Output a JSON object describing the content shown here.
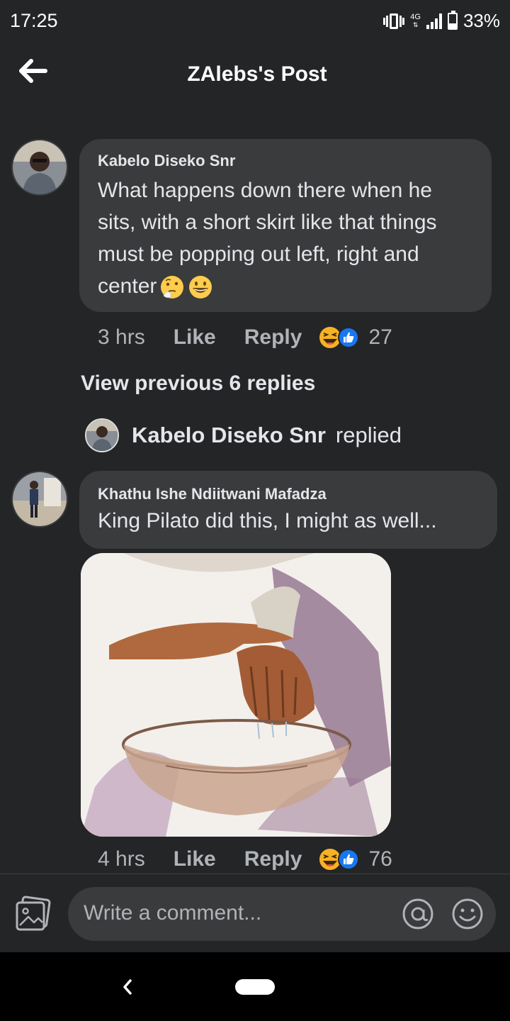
{
  "status_bar": {
    "time": "17:25",
    "network": "4G",
    "battery": "33%",
    "battery_level": 0.33
  },
  "header": {
    "title": "ZAlebs's Post",
    "back_icon": "arrow-left-icon"
  },
  "comments": [
    {
      "author": "Kabelo Diseko Snr",
      "text": "What happens down there when he sits, with a short skirt like that things must be popping out left, right and center",
      "emojis": [
        "thinking-face-icon",
        "grinning-face-icon"
      ],
      "time": "3 hrs",
      "like_label": "Like",
      "reply_label": "Reply",
      "reactions": [
        "laugh-reaction-icon",
        "like-reaction-icon"
      ],
      "reaction_count": "27"
    },
    {
      "author": "Khathu Ishe Ndiitwani Mafadza",
      "text": "King Pilato did this, I might as well...",
      "time": "4 hrs",
      "like_label": "Like",
      "reply_label": "Reply",
      "reactions": [
        "laugh-reaction-icon",
        "like-reaction-icon"
      ],
      "reaction_count": "76",
      "attachment": "illustration of hands washing in a bowl"
    }
  ],
  "view_previous": "View previous 6 replies",
  "replied_row": {
    "name": "Kabelo Diseko Snr",
    "word": "replied"
  },
  "composer": {
    "placeholder": "Write a comment...",
    "icons": [
      "photo-icon",
      "at-mention-icon",
      "smiley-icon"
    ]
  },
  "colors": {
    "background": "#242526",
    "bubble": "#3a3b3c",
    "text": "#e4e6eb",
    "muted": "#b0b3b8",
    "like_blue": "#1877f2",
    "laugh_yellow": "#f7b125"
  }
}
